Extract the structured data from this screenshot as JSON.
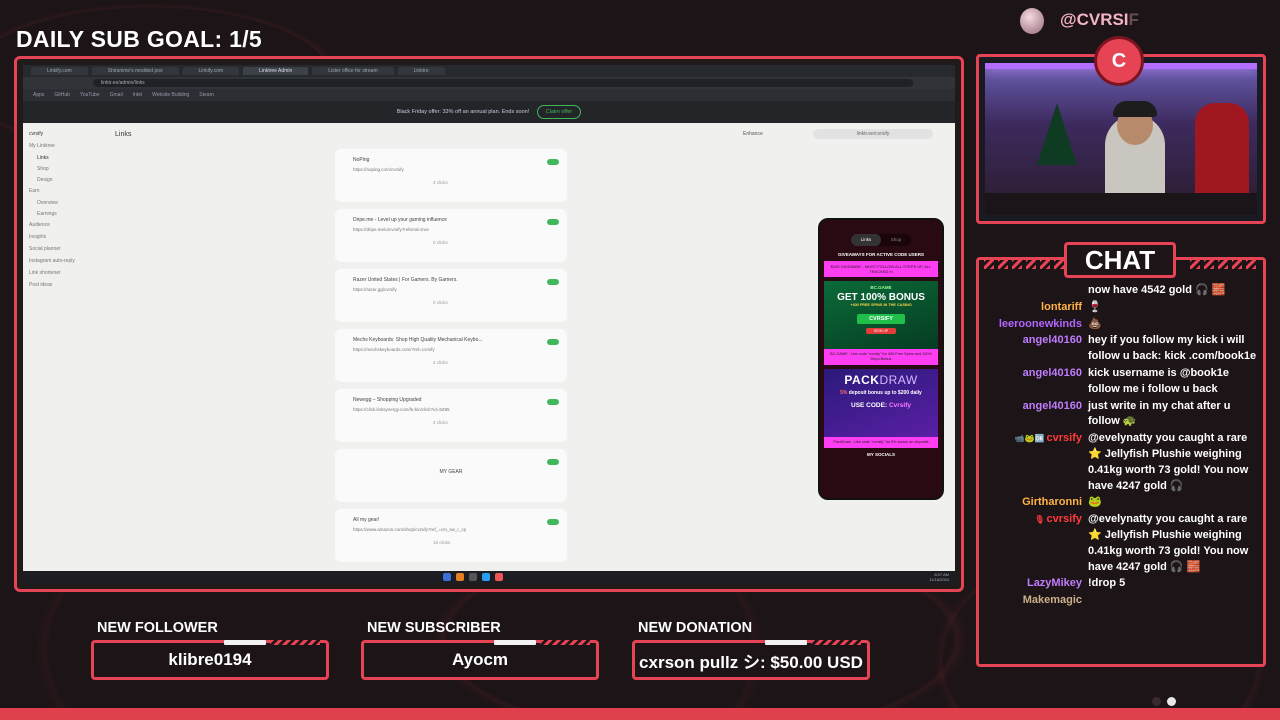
{
  "goal": {
    "title": "DAILY SUB GOAL: 1/5"
  },
  "brand": {
    "handle": "@CVRSI",
    "handle_fade": "F",
    "badge": "C"
  },
  "screen": {
    "tabs": [
      "Linkify.com",
      "Shiranime's modded pos",
      "Linkify.com",
      "Linktree Admin",
      "Lister office for stream",
      "Linktre"
    ],
    "url": "linktr.ee/admin/links",
    "bookmarks": [
      "Apps",
      "GitHub",
      "YouTube",
      "Gmail",
      "Intel",
      "Website Building",
      "Steam"
    ],
    "promo_text": "Black Friday offer: 33% off an annual plan. Ends soon!",
    "promo_button": "Claim offer",
    "app_title": "Links",
    "enhance_label": "Enhance",
    "profile_url": "linktr.ee/cvrsify",
    "sidebar": {
      "account": "cvrsify",
      "items": [
        "My Linktree",
        "Links",
        "Shop",
        "Design",
        "Earn",
        "Overview",
        "Earnings",
        "Audience",
        "Insights",
        "Social planner",
        "Instagram auto-reply",
        "Link shortener",
        "Post ideas"
      ]
    },
    "links": [
      {
        "title": "NoPing",
        "url": "https://noping.com/cvrsify",
        "clicks": "3 clicks"
      },
      {
        "title": "Dripe.me - Level up your gaming influence",
        "url": "https://dripe.me/u/cvrsify?referral=true",
        "clicks": "0 clicks"
      },
      {
        "title": "Razer United States | For Gamers. By Gamers.",
        "url": "https://razer.gg/cvrsify",
        "clicks": "0 clicks"
      },
      {
        "title": "Mechs Keyboards: Shop High Quality Mechanical Keybo...",
        "url": "https://mechskeyboards.com/?ref=cvrsify",
        "clicks": "2 clicks"
      },
      {
        "title": "Newegg – Shopping Upgraded",
        "url": "https://click.linksynergy.com/fs-bin/click?id=5Z95",
        "clicks": "2 clicks"
      },
      {
        "title": "MY GEAR",
        "url": "",
        "clicks": ""
      },
      {
        "title": "All my gear!",
        "url": "https://www.amazon.com/shop/cvrsify?ref_=cm_sw_r_cp",
        "clicks": "18 clicks"
      }
    ],
    "taskbar_time": "8:07 AM",
    "taskbar_date": "11/18/2024"
  },
  "phone": {
    "tab_links": "Links",
    "tab_shop": "Shop",
    "giveaways": "GIVEAWAYS FOR ACTIVE CODE USERS",
    "giveaway_note": "$100 GIVEAWAY - MUST FOLLOW ALL STEPS UP, ALL TRACKED in",
    "bc_logo": "BC.GAME",
    "bc_bonus": "GET 100% BONUS",
    "bc_spins": "+400 FREE SPINS IN THE CASINO",
    "bc_code": "CVRSIFY",
    "bc_signup": "SIGN UP",
    "bc_note": "BC.GAME : Use code \"cvrsify\" for 400 Free Spins and 100% Depo Bonus",
    "pack_logo_a": "PACK",
    "pack_logo_b": "DRAW",
    "pack_desc_pct": "5%",
    "pack_desc": " deposit bonus up to $200 daily",
    "pack_use": "USE CODE: ",
    "pack_code": "Cvrsify",
    "pack_note": "PackDraw - Use code \"cvrsify\" for 5% bonus on deposits",
    "socials": "MY SOCIALS"
  },
  "chat": {
    "header": "CHAT",
    "messages": [
      {
        "user": "",
        "color": "#c07cff",
        "text": "now have 4542 gold 🎧 🧱"
      },
      {
        "user": "lontariff",
        "color": "#ffb347",
        "text": "🍷"
      },
      {
        "user": "leeroonewkinds",
        "color": "#b266ff",
        "text": "💩"
      },
      {
        "user": "angel40160",
        "color": "#c07cff",
        "text": "hey if you follow my kick i will follow u back: kick .com/book1e"
      },
      {
        "user": "angel40160",
        "color": "#c07cff",
        "text": "kick username is @book1e follow me i follow u back"
      },
      {
        "user": "angel40160",
        "color": "#c07cff",
        "text": "just write in my chat after u follow 🐢"
      },
      {
        "user": "cvrsify",
        "color": "#ff3b3b",
        "badges": "📹🐸🆗",
        "text": "@evelynatty you caught a rare ⭐ Jellyfish Plushie weighing 0.41kg worth 73 gold! You now have 4247 gold 🎧"
      },
      {
        "user": "Girtharonni",
        "color": "#ffb347",
        "text": "🐸"
      },
      {
        "user": "cvrsify",
        "color": "#ff3b3b",
        "badges": "🎙",
        "text": "@evelynatty you caught a rare ⭐ Jellyfish Plushie weighing 0.41kg worth 73 gold! You now have 4247 gold 🎧 🧱"
      },
      {
        "user": "LazyMikey",
        "color": "#c07cff",
        "text": "!drop 5"
      },
      {
        "user": "Makemagic",
        "color": "#c9b08a",
        "text": ""
      }
    ]
  },
  "alerts": {
    "follower": {
      "label": "NEW FOLLOWER",
      "value": "klibre0194"
    },
    "subscriber": {
      "label": "NEW SUBSCRIBER",
      "value": "Ayocm"
    },
    "donation": {
      "label": "NEW DONATION",
      "value": "cxrson pullz シ: $50.00 USD"
    }
  },
  "colors": {
    "accent": "#e64454",
    "background": "#1c1416"
  }
}
